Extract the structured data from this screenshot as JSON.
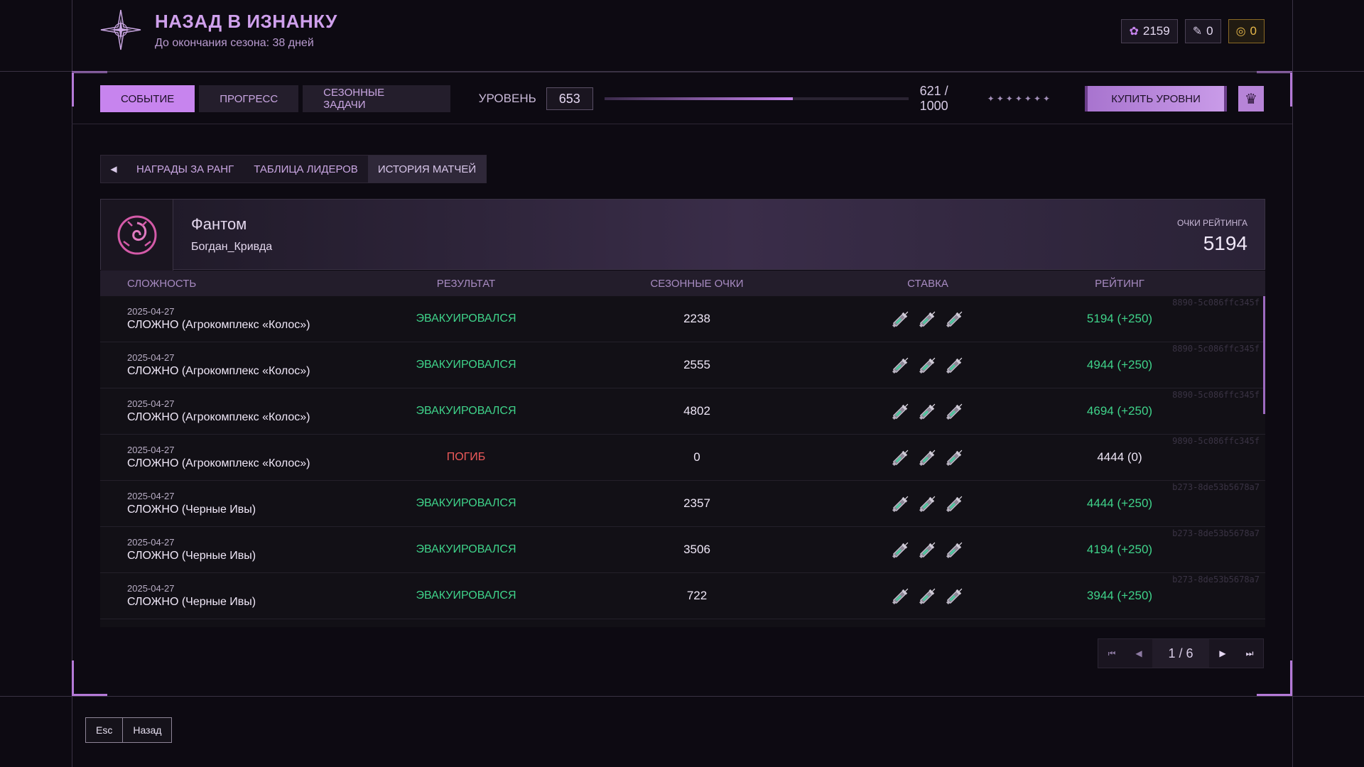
{
  "header": {
    "title": "НАЗАД В ИЗНАНКУ",
    "subtitle": "До окончания сезона: 38 дней",
    "currencies": [
      {
        "icon": "flower-currency-icon",
        "value": "2159"
      },
      {
        "icon": "ticket-icon",
        "value": "0"
      },
      {
        "icon": "gold-coin-icon",
        "value": "0"
      }
    ]
  },
  "topbar": {
    "tabs": [
      {
        "label": "СОБЫТИЕ",
        "active": true
      },
      {
        "label": "ПРОГРЕСС",
        "active": false
      },
      {
        "label": "СЕЗОННЫЕ ЗАДАЧИ",
        "active": false
      }
    ],
    "level_label": "УРОВЕНЬ",
    "level_value": "653",
    "xp_text": "621 / 1000",
    "xp_fraction": 0.621,
    "buy_label": "КУПИТЬ УРОВНИ"
  },
  "subtabs": [
    {
      "label": "НАГРАДЫ ЗА РАНГ",
      "active": false
    },
    {
      "label": "ТАБЛИЦА ЛИДЕРОВ",
      "active": false
    },
    {
      "label": "ИСТОРИЯ МАТЧЕЙ",
      "active": true
    }
  ],
  "profile": {
    "name": "Фантом",
    "username": "Богдан_Кривда",
    "rating_label": "ОЧКИ РЕЙТИНГА",
    "rating_value": "5194"
  },
  "table": {
    "headers": [
      "СЛОЖНОСТЬ",
      "РЕЗУЛЬТАТ",
      "СЕЗОННЫЕ ОЧКИ",
      "СТАВКА",
      "РЕЙТИНГ"
    ],
    "rows": [
      {
        "date": "2025-04-27",
        "mode": "СЛОЖНО (Агрокомплекс «Колос»)",
        "result": "ЭВАКУИРОВАЛСЯ",
        "status": "ok",
        "points": "2238",
        "rating": "5194 (+250)",
        "id": "8890-5c086ffc345f"
      },
      {
        "date": "2025-04-27",
        "mode": "СЛОЖНО (Агрокомплекс «Колос»)",
        "result": "ЭВАКУИРОВАЛСЯ",
        "status": "ok",
        "points": "2555",
        "rating": "4944 (+250)",
        "id": "8890-5c086ffc345f"
      },
      {
        "date": "2025-04-27",
        "mode": "СЛОЖНО (Агрокомплекс «Колос»)",
        "result": "ЭВАКУИРОВАЛСЯ",
        "status": "ok",
        "points": "4802",
        "rating": "4694 (+250)",
        "id": "8890-5c086ffc345f"
      },
      {
        "date": "2025-04-27",
        "mode": "СЛОЖНО (Агрокомплекс «Колос»)",
        "result": "ПОГИБ",
        "status": "dead",
        "points": "0",
        "rating": "4444 (0)",
        "id": "9890-5c086ffc345f"
      },
      {
        "date": "2025-04-27",
        "mode": "СЛОЖНО (Черные Ивы)",
        "result": "ЭВАКУИРОВАЛСЯ",
        "status": "ok",
        "points": "2357",
        "rating": "4444 (+250)",
        "id": "b273-8de53b5678a7"
      },
      {
        "date": "2025-04-27",
        "mode": "СЛОЖНО (Черные Ивы)",
        "result": "ЭВАКУИРОВАЛСЯ",
        "status": "ok",
        "points": "3506",
        "rating": "4194 (+250)",
        "id": "b273-8de53b5678a7"
      },
      {
        "date": "2025-04-27",
        "mode": "СЛОЖНО (Черные Ивы)",
        "result": "ЭВАКУИРОВАЛСЯ",
        "status": "ok",
        "points": "722",
        "rating": "3944 (+250)",
        "id": "b273-8de53b5678a7"
      }
    ]
  },
  "pagination": {
    "text": "1 / 6"
  },
  "footer": {
    "key": "Esc",
    "action": "Назад"
  },
  "colors": {
    "accent": "#c784ee",
    "success": "#3fd38a",
    "danger": "#ee5a5a",
    "gold": "#e8b94a"
  }
}
